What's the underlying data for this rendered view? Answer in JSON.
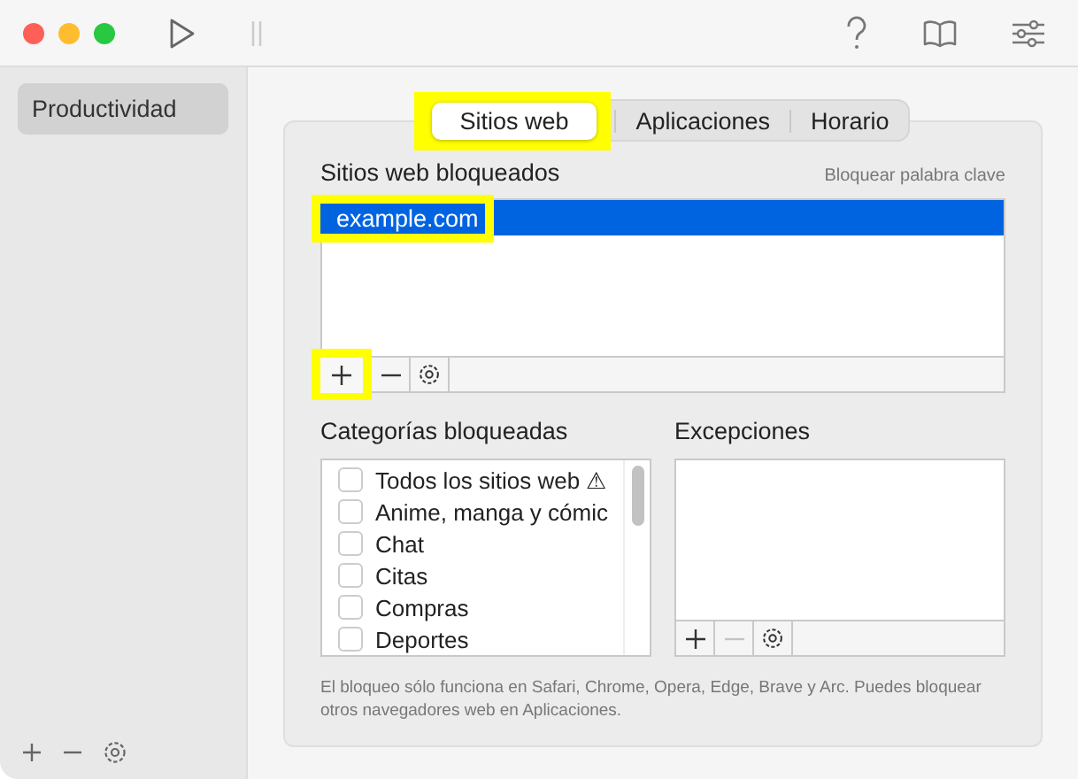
{
  "sidebar": {
    "items": [
      {
        "label": "Productividad",
        "selected": true
      }
    ]
  },
  "tabs": [
    {
      "label": "Sitios web",
      "selected": true,
      "highlighted": true
    },
    {
      "label": "Aplicaciones",
      "selected": false,
      "highlighted": false
    },
    {
      "label": "Horario",
      "selected": false,
      "highlighted": false
    }
  ],
  "blocked_sites": {
    "title": "Sitios web bloqueados",
    "keyword_link": "Bloquear palabra clave",
    "items": [
      {
        "label": "example.com",
        "selected": true,
        "highlighted": true
      }
    ],
    "toolbar": [
      {
        "kind": "add",
        "disabled": false,
        "highlighted": true
      },
      {
        "kind": "remove",
        "disabled": false,
        "highlighted": false
      },
      {
        "kind": "settings",
        "disabled": false,
        "highlighted": false
      }
    ]
  },
  "categories": {
    "title": "Categorías bloqueadas",
    "items": [
      {
        "label": "Todos los sitios web ⚠",
        "checked": false
      },
      {
        "label": "Anime, manga y cómic",
        "checked": false
      },
      {
        "label": "Chat",
        "checked": false
      },
      {
        "label": "Citas",
        "checked": false
      },
      {
        "label": "Compras",
        "checked": false
      },
      {
        "label": "Deportes",
        "checked": false
      }
    ]
  },
  "exceptions": {
    "title": "Excepciones",
    "toolbar": [
      {
        "kind": "add",
        "disabled": false
      },
      {
        "kind": "remove",
        "disabled": true
      },
      {
        "kind": "settings",
        "disabled": false
      }
    ]
  },
  "footnote": "El bloqueo sólo funciona en Safari, Chrome, Opera, Edge, Brave y Arc. Puedes bloquear otros navegadores web en Aplicaciones."
}
